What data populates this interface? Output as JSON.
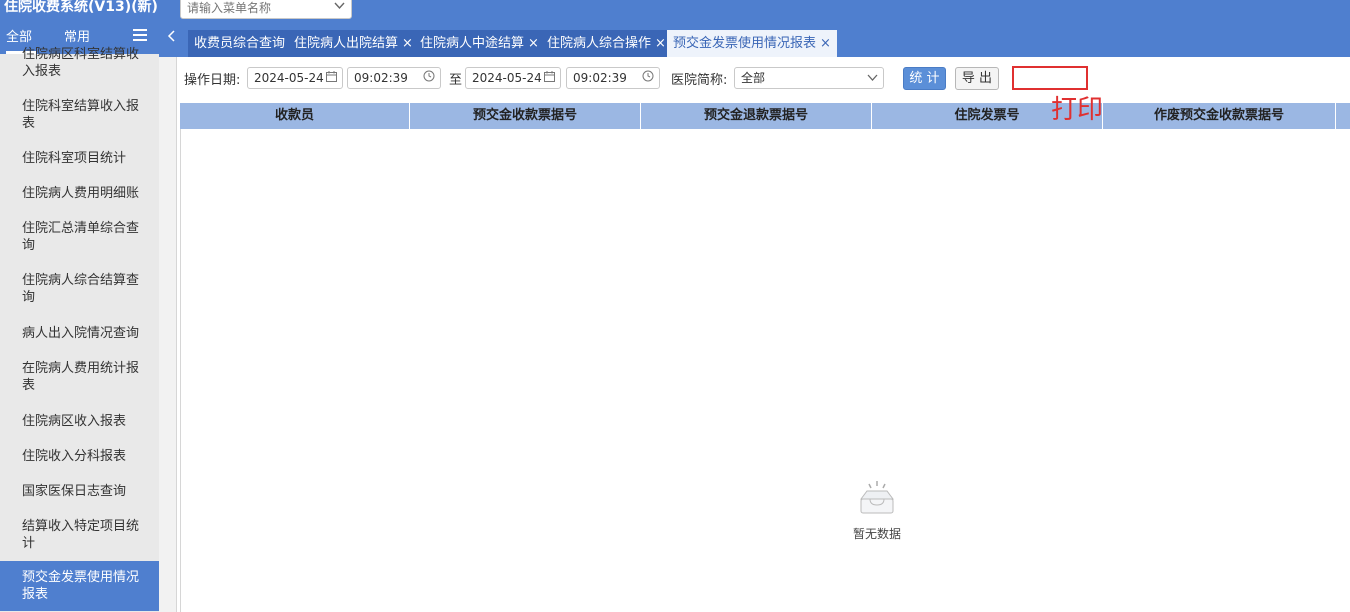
{
  "app": {
    "title": "住院收费系统(V13)(新)"
  },
  "search": {
    "placeholder": "请输入菜单名称"
  },
  "sidebar": {
    "tabs": [
      "全部",
      "常用"
    ],
    "items": [
      "住院病区科室结算收入报表",
      "住院科室结算收入报表",
      "住院科室项目统计",
      "住院病人费用明细账",
      "住院汇总清单综合查询",
      "住院病人综合结算查询",
      "病人出入院情况查询",
      "在院病人费用统计报表",
      "住院病区收入报表",
      "住院收入分科报表",
      "国家医保日志查询",
      "结算收入特定项目统计",
      "预交金发票使用情况报表"
    ]
  },
  "tabs": [
    {
      "label": "收费员综合查询",
      "closable": false
    },
    {
      "label": "住院病人出院结算",
      "closable": true
    },
    {
      "label": "住院病人中途结算",
      "closable": true
    },
    {
      "label": "住院病人综合操作",
      "closable": true
    },
    {
      "label": "预交金发票使用情况报表",
      "closable": true,
      "active": true
    }
  ],
  "filters": {
    "date_label": "操作日期:",
    "start_date": "2024-05-24",
    "start_time": "09:02:39",
    "to_label": "至",
    "end_date": "2024-05-24",
    "end_time": "09:02:39",
    "hospital_label": "医院简称:",
    "hospital_value": "全部",
    "stat_button": "统 计",
    "export_button": "导 出"
  },
  "annotation": {
    "text": "打印",
    "color": "#e03030"
  },
  "table": {
    "columns": [
      "收款员",
      "预交金收款票据号",
      "预交金退款票据号",
      "住院发票号",
      "作废预交金收款票据号"
    ]
  },
  "empty_state": {
    "text": "暂无数据"
  },
  "colors": {
    "primary": "#4f7fcf",
    "header": "#9bb7e3",
    "annotation": "#e03030"
  }
}
